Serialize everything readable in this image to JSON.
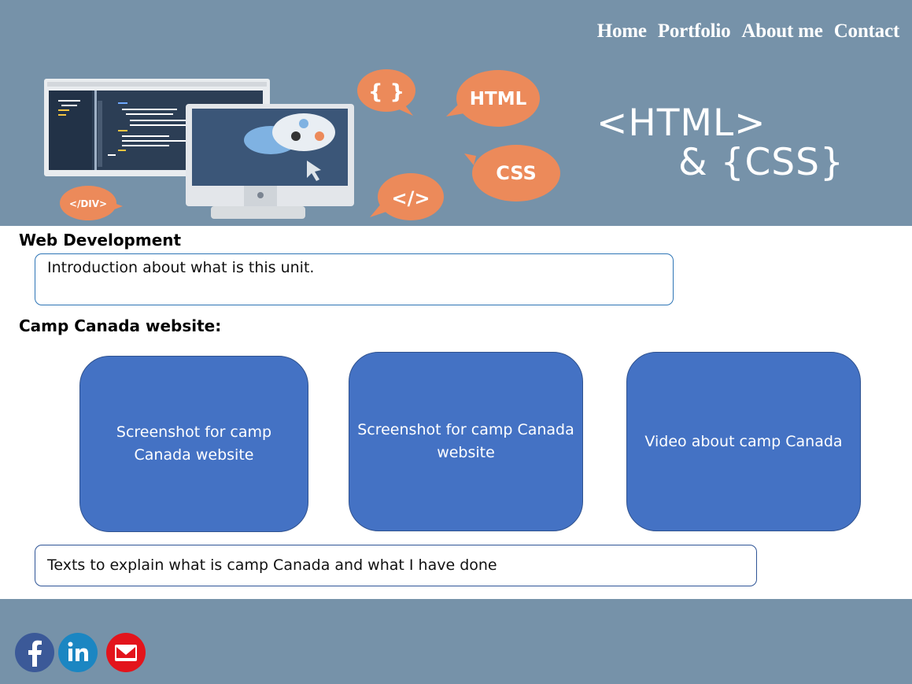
{
  "nav": {
    "items": [
      "Home",
      "Portfolio",
      "About me",
      "Contact"
    ]
  },
  "banner": {
    "title_line1": "<HTML>",
    "title_line2": "& {CSS}",
    "bubbles": {
      "braces": "{ }",
      "html": "HTML",
      "css": "CSS",
      "close_tag": "</>",
      "div": "</DIV>"
    }
  },
  "sections": {
    "web_dev_heading": "Web Development",
    "intro_text": "Introduction about what is this unit.",
    "camp_heading": "Camp Canada website:",
    "cards": [
      {
        "line1": "Screenshot for camp",
        "line2": "Canada website"
      },
      {
        "line1": "Screenshot for camp Canada",
        "line2": "website"
      },
      {
        "line1": "Video about camp Canada",
        "line2": ""
      }
    ],
    "explain_text": "Texts to explain what is camp Canada and what I have done"
  },
  "footer": {
    "icons": [
      "facebook-icon",
      "linkedin-icon",
      "email-icon"
    ]
  },
  "colors": {
    "header_bg": "#7692a9",
    "card_bg": "#4472c4",
    "bubble": "#ec8a5a",
    "box_border": "#2e75b6"
  }
}
